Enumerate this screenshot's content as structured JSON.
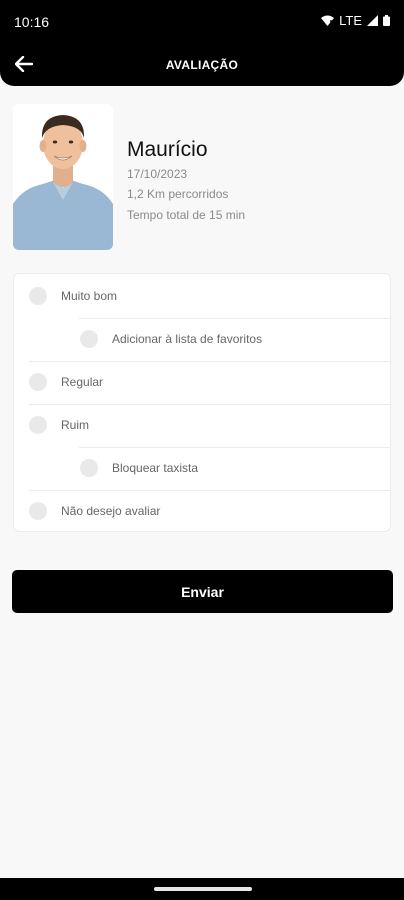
{
  "status_bar": {
    "time": "10:16",
    "network": "LTE"
  },
  "header": {
    "title": "AVALIAÇÃO"
  },
  "driver": {
    "name": "Maurício",
    "date": "17/10/2023",
    "distance": "1,2 Km percorridos",
    "total_time": "Tempo total de 15 min"
  },
  "options": {
    "muito_bom": "Muito bom",
    "add_favorites": "Adicionar à lista de favoritos",
    "regular": "Regular",
    "ruim": "Ruim",
    "block_driver": "Bloquear taxista",
    "no_rate": "Não desejo avaliar"
  },
  "submit": {
    "label": "Enviar"
  },
  "colors": {
    "primary": "#000000",
    "background": "#f8f8f8",
    "radio": "#e9e9e9",
    "muted_text": "#8a8a8a"
  }
}
